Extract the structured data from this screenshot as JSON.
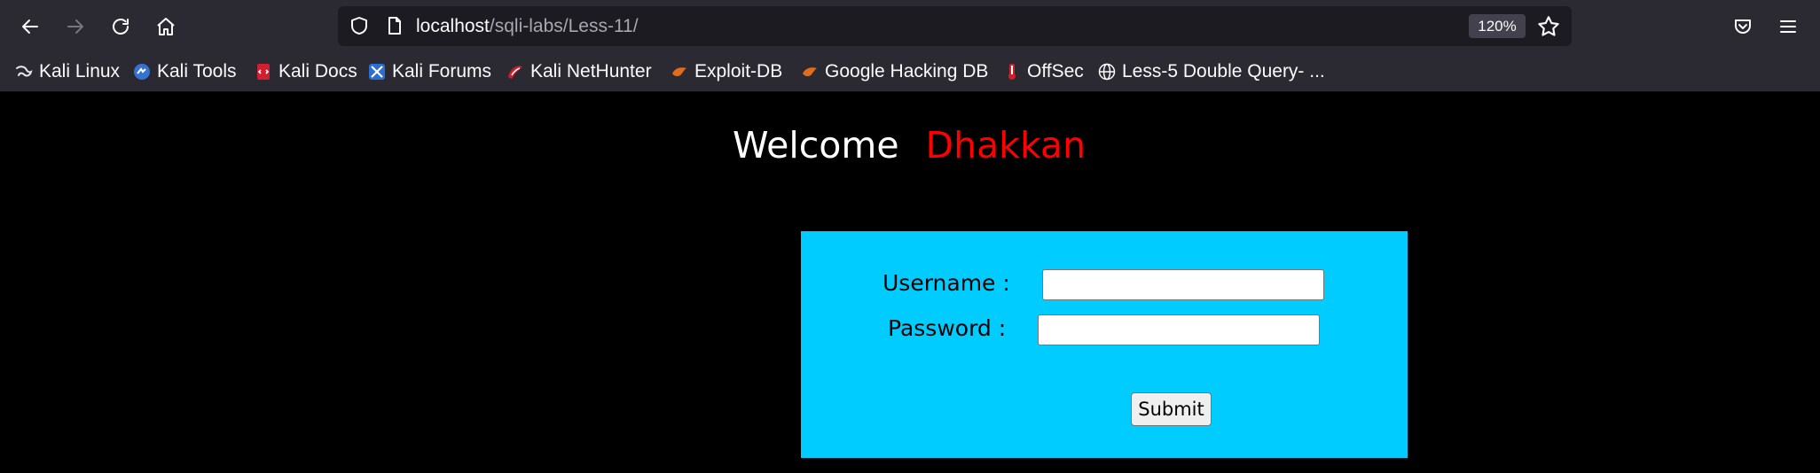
{
  "browser": {
    "url_host": "localhost",
    "url_path": "/sqli-labs/Less-11/",
    "zoom": "120%"
  },
  "bookmarks": [
    {
      "label": "Kali Linux",
      "icon": "kali-dragon-icon"
    },
    {
      "label": "Kali Tools",
      "icon": "kali-tools-icon"
    },
    {
      "label": "Kali Docs",
      "icon": "kali-docs-icon"
    },
    {
      "label": "Kali Forums",
      "icon": "kali-forums-icon"
    },
    {
      "label": "Kali NetHunter",
      "icon": "kali-nethunter-icon"
    },
    {
      "label": "Exploit-DB",
      "icon": "exploit-db-icon"
    },
    {
      "label": "Google Hacking DB",
      "icon": "ghdb-icon"
    },
    {
      "label": "OffSec",
      "icon": "offsec-icon"
    },
    {
      "label": "Less-5 Double Query- ...",
      "icon": "globe-icon"
    }
  ],
  "page": {
    "welcome": "Welcome",
    "name": "Dhakkan",
    "username_label": "Username :",
    "password_label": "Password :",
    "username_value": "",
    "password_value": "",
    "submit_label": "Submit"
  },
  "colors": {
    "form_bg": "#00ccff",
    "accent_red": "#ff0000",
    "toolbar_bg": "#2b2a33"
  }
}
